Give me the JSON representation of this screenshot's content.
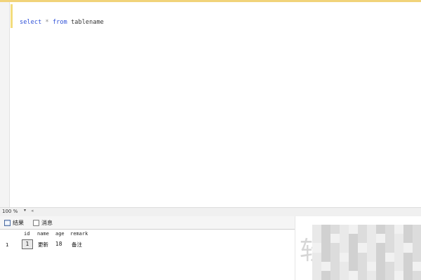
{
  "editor": {
    "query_tokens": {
      "select": "select",
      "star": "*",
      "from": "from",
      "table": "tablename"
    }
  },
  "statusbar": {
    "zoom": "100 %",
    "zoom_arrow": "▾"
  },
  "results": {
    "tabs": [
      {
        "label": "结果",
        "icon": "grid-icon"
      },
      {
        "label": "消息",
        "icon": "message-icon"
      }
    ],
    "columns": [
      "id",
      "name",
      "age",
      "remark"
    ],
    "rows": [
      {
        "row_number": "1",
        "id": "1",
        "name": "更新",
        "age": "18",
        "remark": "备注"
      }
    ]
  },
  "watermark": {
    "char": "软"
  },
  "colors": {
    "keyword": "#2d4fd8",
    "change_bar": "#f3dc7c"
  }
}
